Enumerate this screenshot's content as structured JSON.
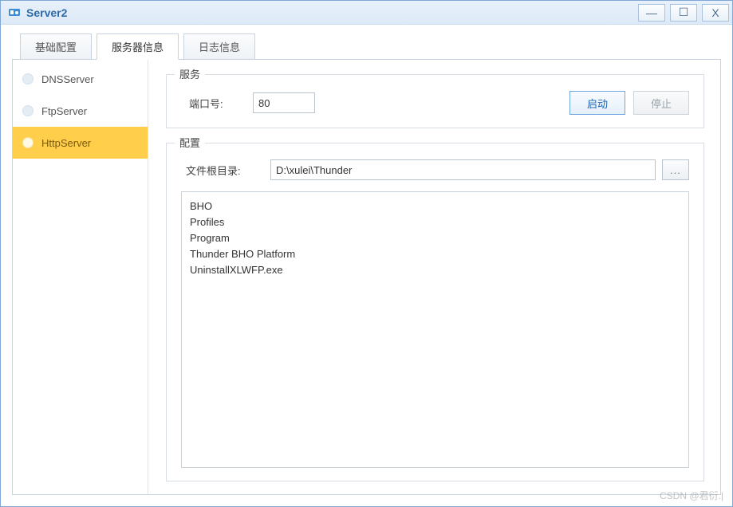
{
  "window": {
    "title": "Server2",
    "controls": {
      "min": "—",
      "max": "☐",
      "close": "X"
    }
  },
  "tabs": [
    {
      "label": "基础配置",
      "active": false
    },
    {
      "label": "服务器信息",
      "active": true
    },
    {
      "label": "日志信息",
      "active": false
    }
  ],
  "sidebar": {
    "items": [
      {
        "label": "DNSServer",
        "active": false
      },
      {
        "label": "FtpServer",
        "active": false
      },
      {
        "label": "HttpServer",
        "active": true
      }
    ]
  },
  "service": {
    "legend": "服务",
    "port_label": "端口号:",
    "port_value": "80",
    "start_btn": "启动",
    "stop_btn": "停止"
  },
  "config": {
    "legend": "配置",
    "root_label": "文件根目录:",
    "root_value": "D:\\xulei\\Thunder",
    "browse": "...",
    "files": [
      "BHO",
      "Profiles",
      "Program",
      "Thunder BHO Platform",
      "UninstallXLWFP.exe"
    ]
  },
  "watermark": "CSDN @君衍.|"
}
